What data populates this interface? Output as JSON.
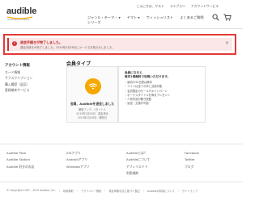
{
  "header": {
    "logo_text": "audible",
    "logo_sub": "an amazon company",
    "nav": [
      {
        "label": "ジャンル・テーマ・",
        "label2": "シリーズ"
      },
      {
        "label": "ヤマト",
        "label2": ""
      },
      {
        "label": "ウィッシュリスト",
        "label2": ""
      },
      {
        "label": "よくあるご質問",
        "label2": ""
      }
    ],
    "util": [
      "こんにちは、ゲスト",
      "ライブラリ",
      "アカウントサービス"
    ]
  },
  "alert": {
    "title": "退会手続きが完了しました。",
    "message": "退会手続きが完了しました。2019年2月26日にメールでお知らせしました。",
    "close_label": "×"
  },
  "sidebar": {
    "title": "アカウント情報",
    "links": [
      "カード情報",
      "サブスクリプション",
      "購入履歴（返品）",
      "登録端末サービス"
    ]
  },
  "main": {
    "title": "会員タイプ",
    "plan": {
      "title": "会員、Audibleを退会しました",
      "notes": [
        "聴取ブック：1タイトル",
        "2019年2月26日：退会済み",
        "2019年2月26日：解約日"
      ]
    },
    "benefits": {
      "heading_1": "会員になると、",
      "heading_2": "毎月1冊無料で利用いただけます。",
      "items": [
        "・最初の30日間は無料",
        "・コインは全ての本と交換可能",
        "・会員限定のセールやキャンペーン",
        "・ボーナスタイトルを毎月プレゼント",
        "・人気作品が聴き放題",
        "・返品・交換が可能"
      ]
    }
  },
  "footer": {
    "columns": [
      [
        "Audible Pack",
        "Audible Station",
        "Audible 好きのお店"
      ],
      [
        "iOSアプリ",
        "Androidアプリ",
        "Windowsアプリ"
      ],
      [
        "Audibleとは？",
        "Audibleについて",
        "アフィリエイト",
        "利用規約"
      ],
      [
        "Facebook",
        "Twitter",
        "ブログ"
      ]
    ],
    "bottom": [
      "© Copyright 1997 - 2019 Audible, Inc.",
      "利用規約",
      "プライバシー規約",
      "特定商取引法に基づく表記",
      "Audibleの利用について",
      "サイトマップ"
    ]
  },
  "colors": {
    "alert_border": "#e53935",
    "alert_bg": "#fbe7e7",
    "brand_orange": "#f7a800"
  }
}
